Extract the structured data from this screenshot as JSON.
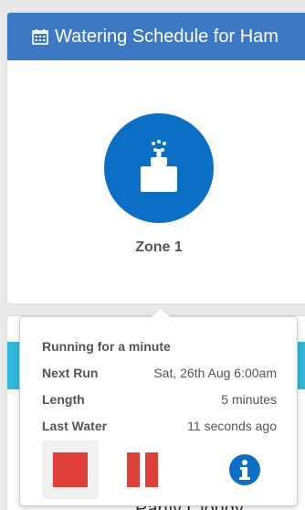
{
  "header": {
    "title": "Watering Schedule for Ham"
  },
  "zone": {
    "label": "Zone 1"
  },
  "weather": {
    "partial_text": "Partly Cloudy"
  },
  "popover": {
    "status": "Running for a minute",
    "rows": [
      {
        "key": "Next Run",
        "value": "Sat, 26th Aug 6:00am"
      },
      {
        "key": "Length",
        "value": "5 minutes"
      },
      {
        "key": "Last Water",
        "value": "11 seconds ago"
      }
    ]
  },
  "colors": {
    "header": "#3d78c5",
    "zone": "#0b6fc6",
    "danger": "#e0403a",
    "strip": "#2fb8d9"
  },
  "icons": {
    "calendar": "calendar-icon",
    "sprinkler": "sprinkler-icon",
    "stop": "stop-icon",
    "pause": "pause-icon",
    "info": "info-icon"
  }
}
